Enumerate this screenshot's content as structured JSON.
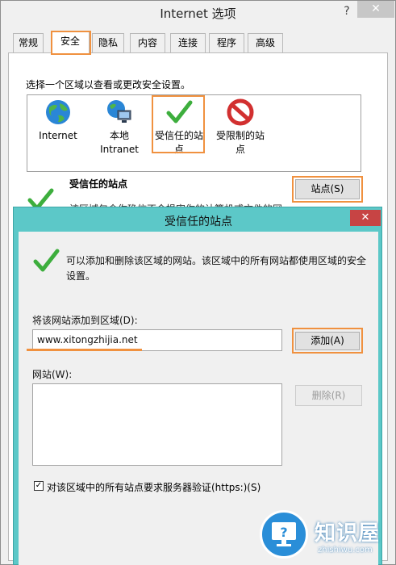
{
  "window": {
    "title": "Internet 选项",
    "help": "?",
    "close": "✕"
  },
  "tabs": [
    "常规",
    "安全",
    "隐私",
    "内容",
    "连接",
    "程序",
    "高级"
  ],
  "security": {
    "prompt": "选择一个区域以查看或更改安全设置。",
    "zones": [
      {
        "line1": "Internet",
        "line2": ""
      },
      {
        "line1": "本地",
        "line2": "Intranet"
      },
      {
        "line1": "受信任的站",
        "line2": "点"
      },
      {
        "line1": "受限制的站",
        "line2": "点"
      }
    ],
    "selected_zone_heading": "受信任的站点",
    "selected_zone_desc": "该区域包含你确信不会损害你的计算机或文件的网",
    "sites_button": "站点(S)"
  },
  "dialog": {
    "title": "受信任的站点",
    "close": "✕",
    "description": "可以添加和删除该区域的网站。该区域中的所有网站都使用区域的安全设置。",
    "add_label": "将该网站添加到区域(D):",
    "add_value": "www.xitongzhijia.net",
    "add_button": "添加(A)",
    "websites_label": "网站(W):",
    "remove_button": "删除(R)",
    "https_checkbox_label": "对该区域中的所有站点要求服务器验证(https:)(S)",
    "https_checked": true
  },
  "watermark": {
    "name": "知识屋",
    "url": "zhishiwu.com"
  },
  "colors": {
    "highlight": "#f0913f",
    "dialog_frame": "#5cc8c8",
    "check_green": "#3dae3d"
  }
}
